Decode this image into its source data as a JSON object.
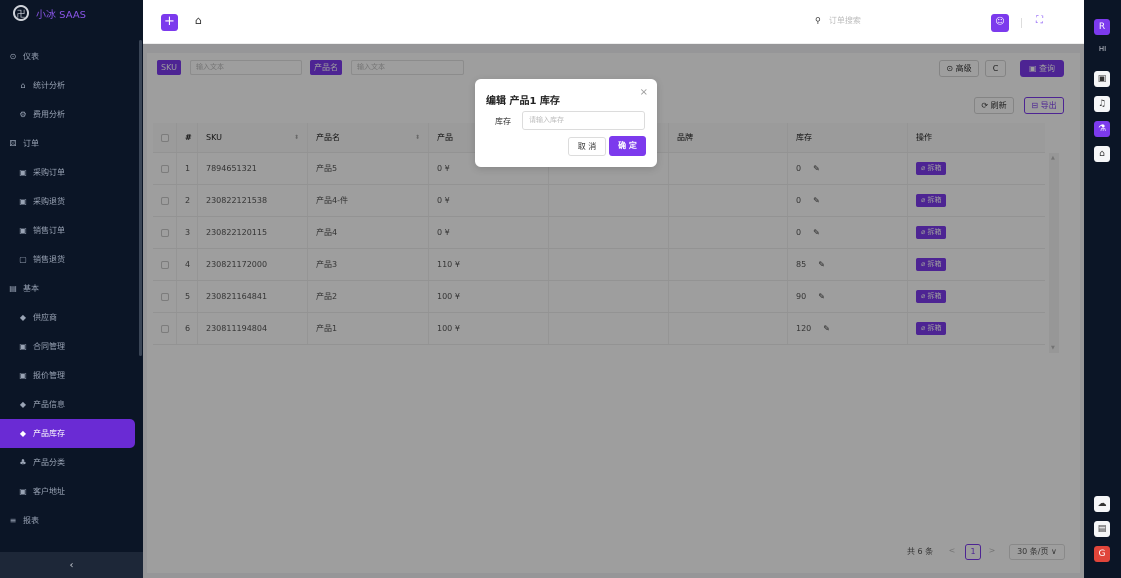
{
  "brand": {
    "mark": "卍",
    "name": "小冰 SAAS"
  },
  "menu": [
    {
      "label": "仪表",
      "icon": "⊙",
      "group": true
    },
    {
      "label": "统计分析",
      "icon": "⌂",
      "group": false
    },
    {
      "label": "费用分析",
      "icon": "⚙",
      "group": false
    },
    {
      "label": "订单",
      "icon": "⚄",
      "group": true
    },
    {
      "label": "采购订单",
      "icon": "▣",
      "group": false
    },
    {
      "label": "采购退货",
      "icon": "▣",
      "group": false
    },
    {
      "label": "销售订单",
      "icon": "▣",
      "group": false
    },
    {
      "label": "销售退货",
      "icon": "▢",
      "group": false
    },
    {
      "label": "基本",
      "icon": "▤",
      "group": true
    },
    {
      "label": "供应商",
      "icon": "◆",
      "group": false
    },
    {
      "label": "合同管理",
      "icon": "▣",
      "group": false
    },
    {
      "label": "报价管理",
      "icon": "▣",
      "group": false
    },
    {
      "label": "产品信息",
      "icon": "◆",
      "group": false
    },
    {
      "label": "产品库存",
      "icon": "◆",
      "group": false,
      "active": true
    },
    {
      "label": "产品分类",
      "icon": "♣",
      "group": false
    },
    {
      "label": "客户地址",
      "icon": "▣",
      "group": false
    },
    {
      "label": "报表",
      "icon": "≡",
      "group": true
    }
  ],
  "collapse_icon": "‹",
  "topbar": {
    "add": "+",
    "home": "⌂",
    "search_icon": "⚲",
    "search_placeholder": "订单搜索",
    "user_icon": "☺",
    "fullscreen_icon": "⛶"
  },
  "rightbar": {
    "r1": "R",
    "hi": "HI",
    "b1": "▣",
    "b2": "♫",
    "b3": "⚗",
    "b4": "⌂",
    "b5": "☁",
    "b6": "▤",
    "b7": "G"
  },
  "filters": {
    "sku_label": "SKU",
    "sku_placeholder": "输入文本",
    "name_label": "产品名",
    "name_placeholder": "输入文本"
  },
  "actions": {
    "advanced": "⊙ 高级",
    "reset": "C",
    "search": "▣ 查询",
    "refresh": "⟳ 刷新",
    "export": "⊟ 导出"
  },
  "table": {
    "headers": [
      "#",
      "SKU",
      "产品名",
      "产品",
      "",
      "品牌",
      "库存",
      "操作"
    ],
    "rows": [
      {
        "idx": "1",
        "sku": "7894651321",
        "name": "产品5",
        "price": "0 ¥",
        "stock": "0"
      },
      {
        "idx": "2",
        "sku": "230822121538",
        "name": "产品4-件",
        "price": "0 ¥",
        "stock": "0"
      },
      {
        "idx": "3",
        "sku": "230822120115",
        "name": "产品4",
        "price": "0 ¥",
        "stock": "0"
      },
      {
        "idx": "4",
        "sku": "230821172000",
        "name": "产品3",
        "price": "110 ¥",
        "stock": "85"
      },
      {
        "idx": "5",
        "sku": "230821164841",
        "name": "产品2",
        "price": "100 ¥",
        "stock": "90"
      },
      {
        "idx": "6",
        "sku": "230811194804",
        "name": "产品1",
        "price": "100 ¥",
        "stock": "120"
      }
    ],
    "unbox_label": "⌀ 拆箱",
    "edit_icon": "✎"
  },
  "pagination": {
    "total": "共 6 条",
    "prev": "<",
    "page": "1",
    "next": ">",
    "size": "30 条/页 ∨"
  },
  "modal": {
    "title": "编辑 产品1 库存",
    "close": "×",
    "label": "库存",
    "placeholder": "请输入库存",
    "cancel": "取 消",
    "ok": "确 定"
  },
  "colors": {
    "accent": "#7c3aed",
    "sidebar": "#0b1526",
    "active": "#6a2bd4"
  }
}
